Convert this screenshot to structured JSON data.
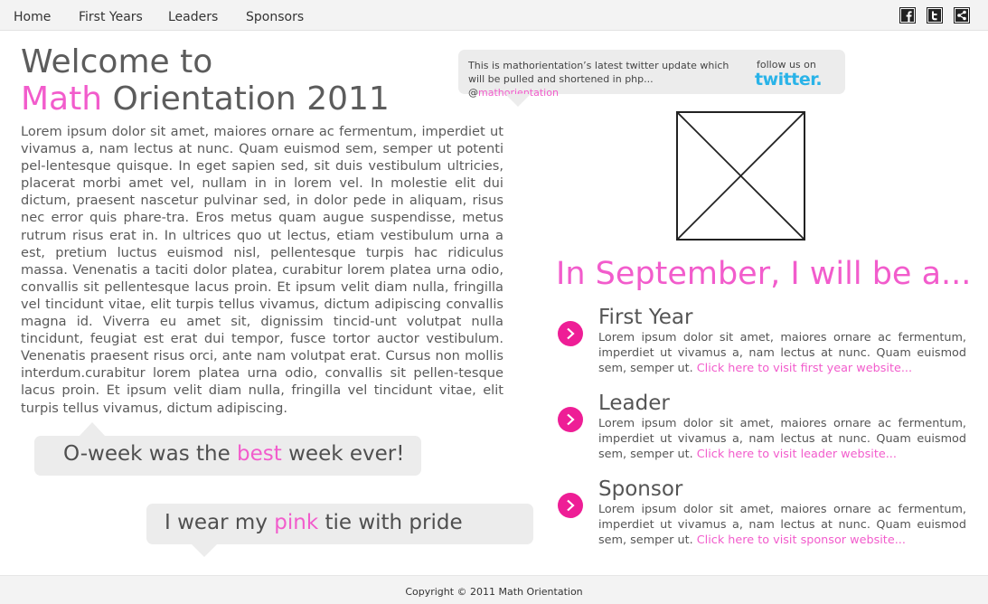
{
  "nav": {
    "items": [
      {
        "label": "Home"
      },
      {
        "label": "First Years"
      },
      {
        "label": "Leaders"
      },
      {
        "label": "Sponsors"
      }
    ],
    "social": [
      {
        "icon": "facebook-icon"
      },
      {
        "icon": "twitter-icon"
      },
      {
        "icon": "share-icon"
      }
    ]
  },
  "heading": {
    "line1": "Welcome to",
    "line2_pink": "Math",
    "line2_rest": " Orientation 2011"
  },
  "intro_text": "Lorem ipsum dolor sit amet, maiores ornare ac fermentum, imperdiet ut vivamus a, nam lectus at nunc. Quam euismod sem, semper ut potenti pel-lentesque quisque. In eget sapien sed, sit duis vestibulum ultricies, placerat morbi amet vel, nullam in in lorem vel. In molestie elit dui dictum, praesent nascetur pulvinar sed, in dolor pede in aliquam, risus nec error quis phare-tra. Eros metus quam augue suspendisse, metus rutrum risus erat in.  In ultrices quo ut lectus, etiam vestibulum urna a est, pretium luctus euismod nisl, pellentesque turpis hac ridiculus massa. Venenatis a taciti dolor platea, curabitur lorem platea urna odio, convallis sit pellentesque lacus proin. Et ipsum velit diam nulla, fringilla vel tincidunt vitae, elit turpis tellus vivamus, dictum adipiscing convallis magna id. Viverra eu amet sit, dignissim tincid-unt volutpat nulla tincidunt, feugiat est erat dui tempor, fusce tortor auctor vestibulum. Venenatis praesent risus orci, ante nam volutpat erat. Cursus non mollis interdum.curabitur lorem platea urna odio, convallis sit pellen-tesque lacus proin. Et ipsum velit diam nulla, fringilla vel tincidunt vitae, elit turpis tellus vivamus, dictum adipiscing.",
  "tweet": {
    "text": "This is mathorientation’s latest twitter update which will be pulled and shortened in php... @",
    "handle": "mathorientation",
    "follow_label": "follow us on",
    "logo_text": "twitter."
  },
  "bubbles": {
    "oweek": {
      "before": "O-week was the ",
      "highlight": "best",
      "after": " week ever!"
    },
    "pinktie": {
      "before": "I wear my ",
      "highlight": "pink",
      "after": " tie with pride"
    }
  },
  "september_heading": "In September, I will be a...",
  "roles": [
    {
      "title": "First Year",
      "text": "Lorem ipsum dolor sit amet, maiores ornare ac fermentum, imperdiet ut vivamus a, nam lectus at nunc. Quam euismod sem, semper ut. ",
      "link": "Click here to visit first year website..."
    },
    {
      "title": "Leader",
      "text": "Lorem ipsum dolor sit amet, maiores ornare ac fermentum, imperdiet ut vivamus a, nam lectus at nunc. Quam euismod sem, semper ut. ",
      "link": "Click here to visit leader website..."
    },
    {
      "title": "Sponsor",
      "text": "Lorem ipsum dolor sit amet, maiores ornare ac fermentum, imperdiet ut vivamus a, nam lectus at nunc. Quam euismod sem, semper ut. ",
      "link": "Click here to visit sponsor website..."
    }
  ],
  "footer": {
    "text": "Copyright © 2011 Math Orientation"
  },
  "colors": {
    "accent_pink": "#f25ccc",
    "arrow_pink": "#ee1e96",
    "bubble_gray": "#ececec",
    "twitter_blue": "#29b3e8"
  }
}
